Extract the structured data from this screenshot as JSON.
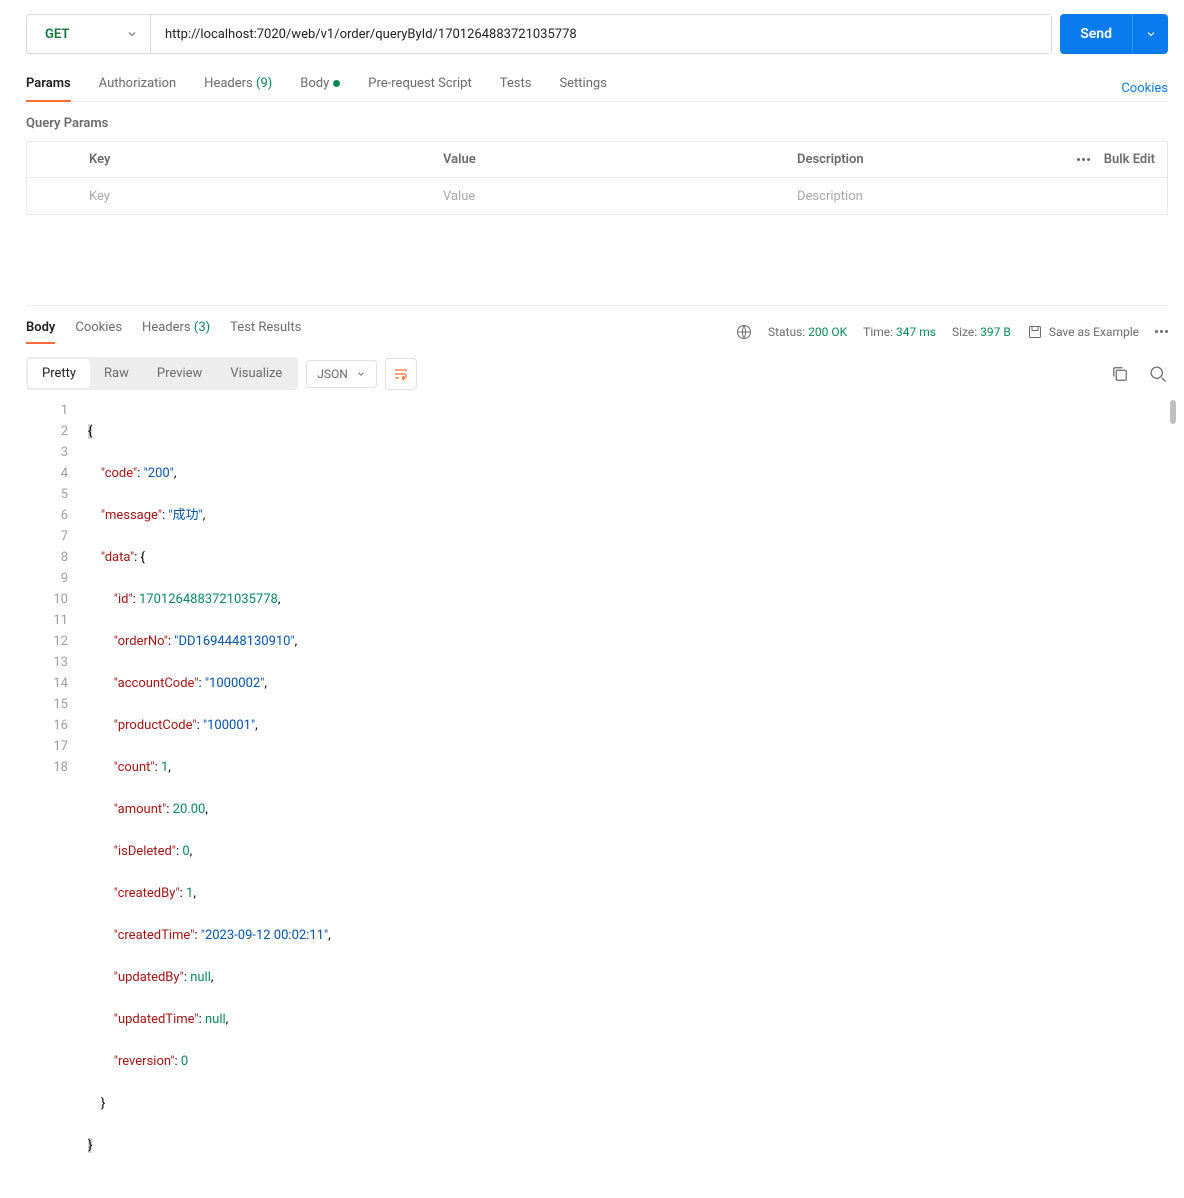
{
  "request": {
    "method": "GET",
    "url": "http://localhost:7020/web/v1/order/queryById/1701264883721035778",
    "send_label": "Send"
  },
  "tabs": {
    "params": "Params",
    "authorization": "Authorization",
    "headers": "Headers",
    "headers_count": "(9)",
    "body": "Body",
    "prerequest": "Pre-request Script",
    "tests": "Tests",
    "settings": "Settings",
    "cookies": "Cookies"
  },
  "params_section": {
    "title": "Query Params",
    "col_key": "Key",
    "col_value": "Value",
    "col_desc": "Description",
    "bulk_edit": "Bulk Edit",
    "ph_key": "Key",
    "ph_value": "Value",
    "ph_desc": "Description"
  },
  "response_tabs": {
    "body": "Body",
    "cookies": "Cookies",
    "headers": "Headers",
    "headers_count": "(3)",
    "tests": "Test Results"
  },
  "response_meta": {
    "status_label": "Status:",
    "status_value": "200 OK",
    "time_label": "Time:",
    "time_value": "347 ms",
    "size_label": "Size:",
    "size_value": "397 B",
    "save_as": "Save as Example"
  },
  "view": {
    "pretty": "Pretty",
    "raw": "Raw",
    "preview": "Preview",
    "visualize": "Visualize",
    "format": "JSON"
  },
  "json_body": {
    "code_key": "\"code\"",
    "code_val": "\"200\"",
    "message_key": "\"message\"",
    "message_val": "\"成功\"",
    "data_key": "\"data\"",
    "id_key": "\"id\"",
    "id_val": "1701264883721035778",
    "orderNo_key": "\"orderNo\"",
    "orderNo_val": "\"DD1694448130910\"",
    "accountCode_key": "\"accountCode\"",
    "accountCode_val": "\"1000002\"",
    "productCode_key": "\"productCode\"",
    "productCode_val": "\"100001\"",
    "count_key": "\"count\"",
    "count_val": "1",
    "amount_key": "\"amount\"",
    "amount_val": "20.00",
    "isDeleted_key": "\"isDeleted\"",
    "isDeleted_val": "0",
    "createdBy_key": "\"createdBy\"",
    "createdBy_val": "1",
    "createdTime_key": "\"createdTime\"",
    "createdTime_val": "\"2023-09-12 00:02:11\"",
    "updatedBy_key": "\"updatedBy\"",
    "updatedBy_val": "null",
    "updatedTime_key": "\"updatedTime\"",
    "updatedTime_val": "null",
    "reversion_key": "\"reversion\"",
    "reversion_val": "0"
  }
}
